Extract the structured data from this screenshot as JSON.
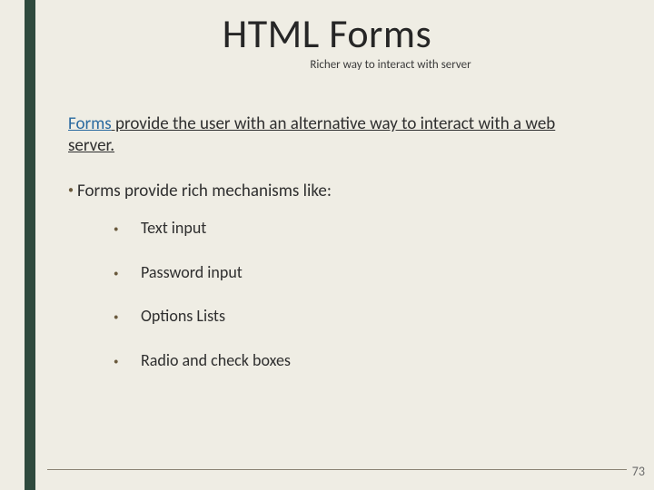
{
  "title": "HTML Forms",
  "subtitle": "Richer way to interact with server",
  "lead_kw": "Forms",
  "lead_rest": " provide the user with an alternative way to interact with a web server.",
  "bullet_top": "Forms provide rich mechanisms like:",
  "items": [
    "Text input",
    "Password input",
    "Options Lists",
    "Radio and check boxes"
  ],
  "page": "73"
}
